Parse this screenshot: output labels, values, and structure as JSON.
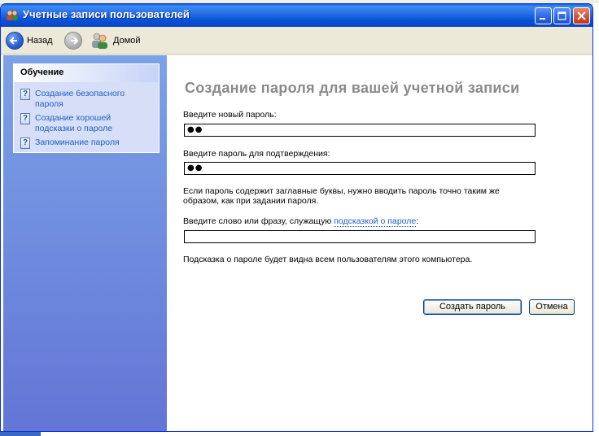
{
  "window": {
    "title": "Учетные записи пользователей"
  },
  "toolbar": {
    "back_label": "Назад",
    "home_label": "Домой"
  },
  "taskpane": {
    "header": "Обучение",
    "items": [
      {
        "label_line1": "Создание безопасного",
        "label_line2": "пароля"
      },
      {
        "label_line1": "Создание хорошей",
        "label_line2": "подсказки о пароле"
      },
      {
        "label_line1": "Запоминание пароля",
        "label_line2": ""
      }
    ]
  },
  "main": {
    "heading": "Создание пароля для вашей учетной записи",
    "new_password_label": "Введите новый пароль:",
    "new_password_value": "●●",
    "confirm_label": "Введите пароль для подтверждения:",
    "confirm_value": "●●",
    "caps_note_line1": "Если пароль содержит заглавные буквы, нужно вводить пароль точно таким же",
    "caps_note_line2": "образом, как при задании пароля.",
    "hint_label_prefix": "Введите слово или фразу, служащую ",
    "hint_label_link": "подсказкой о пароле",
    "hint_label_suffix": ":",
    "hint_value": "",
    "hint_note": "Подсказка о пароле будет видна всем пользователям этого компьютера.",
    "create_button": "Создать пароль",
    "cancel_button": "Отмена"
  },
  "colors": {
    "titlebar": "#0a5fdd",
    "taskpane_top": "#7ba2e7",
    "taskpane_bottom": "#6375d6",
    "link": "#215dc6",
    "heading": "#8a8a8a"
  },
  "icons": {
    "window_icon": "users-icon",
    "back": "back-arrow-icon",
    "forward": "forward-arrow-icon",
    "home": "users-home-icon",
    "help": "help-question-icon"
  }
}
